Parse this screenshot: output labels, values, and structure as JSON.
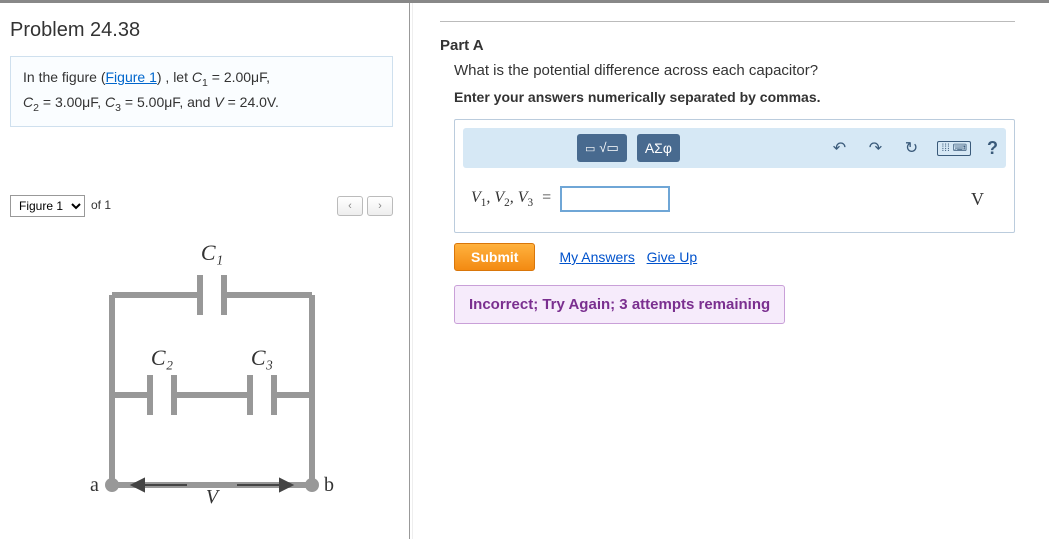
{
  "problem_title": "Problem 24.38",
  "problem_statement_prefix": "In the figure (",
  "problem_figure_link": "Figure 1",
  "problem_statement_suffix": ") , let ",
  "given": {
    "C1": "2.00μF",
    "C2": "3.00μF",
    "C3": "5.00μF",
    "V": "24.0V"
  },
  "figure_bar": {
    "select_label": "Figure 1",
    "of_text": "of 1",
    "prev": "‹",
    "next": "›"
  },
  "figure_labels": {
    "C1": "C₁",
    "C2": "C₂",
    "C3": "C₃",
    "a": "a",
    "b": "b",
    "V": "V"
  },
  "partA": {
    "label": "Part A",
    "question": "What is the potential difference across each capacitor?",
    "instruction": "Enter your answers numerically separated by commas.",
    "toolbar": {
      "template_tip": "▢√▢",
      "greek": "ΑΣφ",
      "undo": "↶",
      "redo": "↷",
      "reset": "↻",
      "keyboard": "⌨",
      "help": "?"
    },
    "input_label": "V₁, V₂, V₃ =",
    "input_value": "",
    "unit": "V",
    "submit": "Submit",
    "my_answers": "My Answers",
    "give_up": "Give Up",
    "feedback": "Incorrect; Try Again; 3 attempts remaining"
  },
  "chart_data": {
    "type": "diagram",
    "description": "Circuit between nodes a and b with voltage V. Top branch: capacitor C1 alone. Bottom branch: capacitors C2 and C3 in series. Both branches in parallel between a and b.",
    "components": [
      {
        "name": "C1",
        "value_uF": 2.0,
        "branch": "top"
      },
      {
        "name": "C2",
        "value_uF": 3.0,
        "branch": "bottom-left"
      },
      {
        "name": "C3",
        "value_uF": 5.0,
        "branch": "bottom-right"
      }
    ],
    "source_voltage_V": 24.0,
    "nodes": [
      "a",
      "b"
    ]
  }
}
